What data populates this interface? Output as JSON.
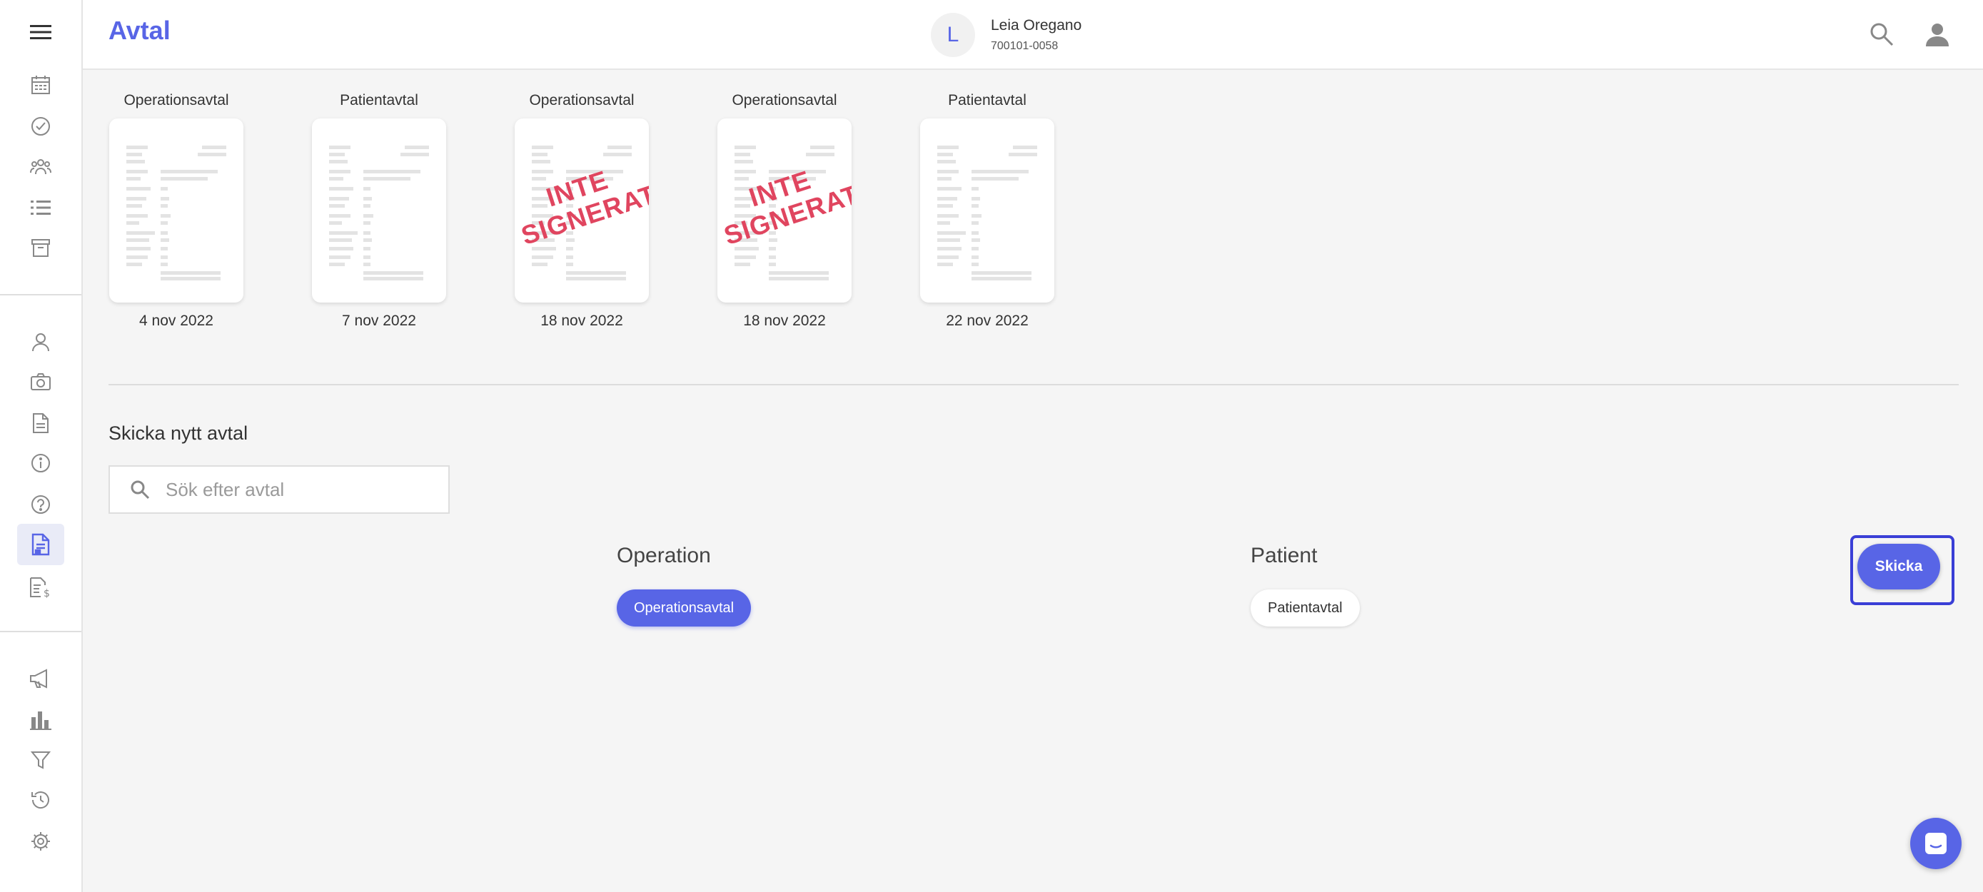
{
  "header": {
    "title": "Avtal",
    "patient_initial": "L",
    "patient_name": "Leia Oregano",
    "patient_id": "700101-0058"
  },
  "sidebar": {
    "items": [
      {
        "icon": "calendar-icon"
      },
      {
        "icon": "check-circle-icon"
      },
      {
        "icon": "group-icon"
      },
      {
        "icon": "list-icon"
      },
      {
        "icon": "archive-icon"
      },
      {
        "icon": "person-icon"
      },
      {
        "icon": "camera-icon"
      },
      {
        "icon": "document-icon"
      },
      {
        "icon": "info-icon"
      },
      {
        "icon": "help-icon"
      },
      {
        "icon": "contract-icon",
        "active": true
      },
      {
        "icon": "invoice-icon"
      },
      {
        "icon": "megaphone-icon"
      },
      {
        "icon": "bar-chart-icon"
      },
      {
        "icon": "filter-icon"
      },
      {
        "icon": "history-icon"
      },
      {
        "icon": "settings-icon"
      }
    ]
  },
  "documents": [
    {
      "label": "Operationsavtal",
      "date": "4 nov 2022",
      "stamp": ""
    },
    {
      "label": "Patientavtal",
      "date": "7 nov 2022",
      "stamp": ""
    },
    {
      "label": "Operationsavtal",
      "date": "18 nov 2022",
      "stamp_line1": "INTE",
      "stamp_line2": "SIGNERAT"
    },
    {
      "label": "Operationsavtal",
      "date": "18 nov 2022",
      "stamp_line1": "INTE",
      "stamp_line2": "SIGNERAT"
    },
    {
      "label": "Patientavtal",
      "date": "22 nov 2022",
      "stamp": ""
    }
  ],
  "send_section": {
    "title": "Skicka nytt avtal",
    "search_placeholder": "Sök efter avtal",
    "categories": [
      {
        "title": "Operation",
        "chips": [
          "Operationsavtal"
        ]
      },
      {
        "title": "Patient",
        "chips": [
          "Patientavtal"
        ]
      }
    ],
    "send_label": "Skicka"
  },
  "colors": {
    "accent": "#5865e6",
    "stamp": "#e0455f",
    "highlight_frame": "#3a3fd6"
  }
}
